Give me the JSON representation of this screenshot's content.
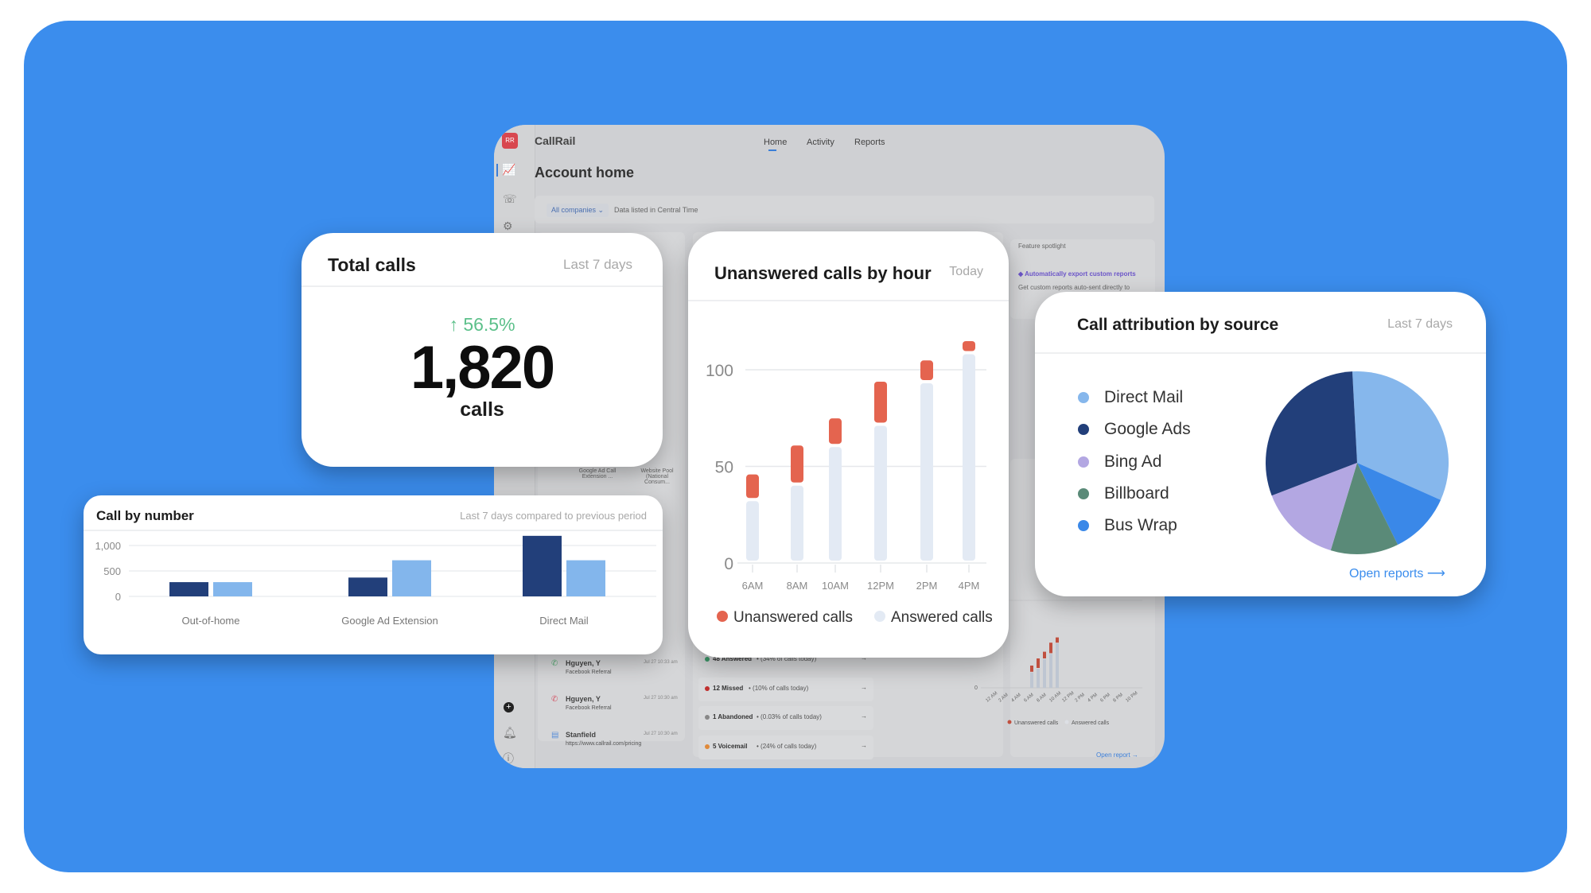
{
  "colors": {
    "background": "#3b8ded",
    "unanswered": "#e4644f",
    "answered": "#e3eaf4",
    "current": "#223f7a",
    "previous": "#83b6ec",
    "positive": "#5cc08a",
    "link": "#3b8ded"
  },
  "app": {
    "logo_initials": "RR",
    "brand": "CallRail",
    "nav": [
      {
        "label": "Home",
        "active": true
      },
      {
        "label": "Activity"
      },
      {
        "label": "Reports"
      }
    ],
    "page_title": "Account home",
    "filter": {
      "company": "All companies",
      "note": "Data listed in Central Time"
    },
    "spotlight": {
      "heading": "Feature spotlight",
      "title": "Automatically export custom reports",
      "body": "Get custom reports auto-sent directly to"
    },
    "bg_bar_labels": [
      "Google Ad Call Extension ...",
      "Website Pool (National Consum..."
    ],
    "activity": [
      {
        "name": "Hguyen, Y",
        "source": "Facebook Referral",
        "time": "Jul 27 10:33 am",
        "icon": "phone-incoming-icon",
        "color": "#5cae78"
      },
      {
        "name": "Hguyen, Y",
        "source": "Facebook Referral",
        "time": "Jul 27 10:30 am",
        "icon": "phone-missed-icon",
        "color": "#d45a6a"
      },
      {
        "name": "Stanfield",
        "source": "https://www.callrail.com/pricing",
        "time": "Jul 27 10:30 am",
        "icon": "form-icon",
        "color": "#5a8fd8"
      }
    ],
    "statuses": [
      {
        "label": "48 Answered",
        "detail": "(34% of calls today)",
        "color": "#3d9a6a"
      },
      {
        "label": "12 Missed",
        "detail": "(10% of calls today)",
        "color": "#c0302f"
      },
      {
        "label": "1 Abandoned",
        "detail": "(0.03% of calls today)",
        "color": "#888888"
      },
      {
        "label": "5 Voicemail",
        "detail": "(24% of calls today)",
        "color": "#e08a3a"
      }
    ],
    "mini_chart": {
      "y_tick": "0",
      "x_ticks": [
        "12 AM",
        "2 AM",
        "4 AM",
        "6 AM",
        "8 AM",
        "10 AM",
        "12 PM",
        "2 PM",
        "4 PM",
        "6 PM",
        "8 PM",
        "10 PM"
      ],
      "legend": [
        "Unanswered calls",
        "Answered calls"
      ],
      "link": "Open report →"
    },
    "sidebar_icons": [
      "analytics-icon",
      "calls-icon",
      "settings-icon",
      "add-icon",
      "notifications-icon",
      "help-icon"
    ]
  },
  "total_calls": {
    "title": "Total calls",
    "period": "Last 7 days",
    "change": "↑ 56.5%",
    "value": "1,820",
    "unit": "calls"
  },
  "chart_data": [
    {
      "type": "bar",
      "title": "Unanswered calls by hour",
      "period": "Today",
      "stacked": true,
      "categories": [
        "6AM",
        "8AM",
        "10AM",
        "12PM",
        "2PM",
        "4PM"
      ],
      "series": [
        {
          "name": "Answered calls",
          "values": [
            32,
            40,
            60,
            71,
            93,
            108
          ]
        },
        {
          "name": "Unanswered calls",
          "values": [
            13,
            20,
            14,
            22,
            11,
            6
          ]
        }
      ],
      "y_ticks": [
        0,
        50,
        100
      ],
      "ylim": [
        0,
        115
      ],
      "grid": true,
      "legend": "bottom"
    },
    {
      "type": "bar",
      "title": "Call by number",
      "period": "Last 7 days compared to previous period",
      "categories": [
        "Out-of-home",
        "Google Ad Extension",
        "Direct Mail"
      ],
      "series": [
        {
          "values": [
            280,
            370,
            1190
          ]
        },
        {
          "values": [
            280,
            710,
            710
          ]
        }
      ],
      "y_ticks": [
        "0",
        "500",
        "1,000"
      ],
      "ylim": [
        0,
        1200
      ],
      "grid": true
    },
    {
      "type": "pie",
      "title": "Call attribution by source",
      "period": "Last 7 days",
      "link": "Open reports ⟶",
      "labels": [
        "Direct Mail",
        "Bus Wrap",
        "Billboard",
        "Bing Ad",
        "Google Ads"
      ],
      "legend_order": [
        "Direct Mail",
        "Google Ads",
        "Bing Ad",
        "Billboard",
        "Bus Wrap"
      ],
      "values": [
        32.5,
        11,
        12,
        14.5,
        30
      ],
      "colors": {
        "Direct Mail": "#86b7ec",
        "Google Ads": "#223f7a",
        "Bing Ad": "#b3a7e2",
        "Billboard": "#5a8a78",
        "Bus Wrap": "#3a88e8"
      },
      "legend": "left"
    }
  ]
}
